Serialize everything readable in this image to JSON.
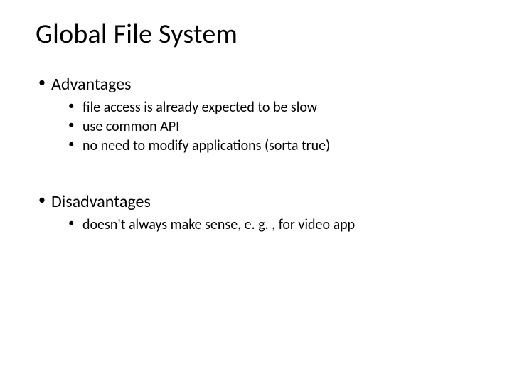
{
  "title": "Global File System",
  "sections": [
    {
      "heading": "Advantages",
      "items": [
        "file access is already expected to be slow",
        "use common API",
        "no need to modify applications (sorta true)"
      ]
    },
    {
      "heading": "Disadvantages",
      "items": [
        "doesn't always make sense, e. g. , for video app"
      ]
    }
  ]
}
